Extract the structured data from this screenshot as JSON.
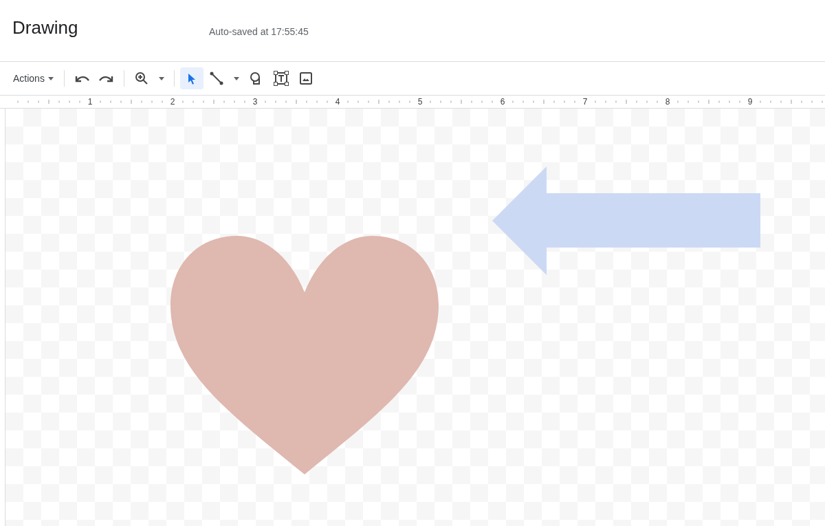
{
  "header": {
    "title": "Drawing",
    "save_status": "Auto-saved at 17:55:45"
  },
  "toolbar": {
    "menu": "Actions",
    "tools": [
      {
        "kind": "undo",
        "selected": false
      },
      {
        "kind": "redo",
        "selected": false
      },
      {
        "kind": "zoom",
        "selected": false
      },
      {
        "kind": "select",
        "selected": true
      },
      {
        "kind": "line",
        "selected": false
      },
      {
        "kind": "shape",
        "selected": false
      },
      {
        "kind": "textbox",
        "selected": false
      },
      {
        "kind": "image",
        "selected": false
      }
    ]
  },
  "ruler": {
    "labels": [
      "1",
      "2",
      "3",
      "4",
      "5",
      "6",
      "7",
      "8",
      "9"
    ]
  },
  "shapes": [
    {
      "kind": "heart",
      "color": "#dfb8b0"
    },
    {
      "kind": "arrow",
      "color": "#cbd9f4"
    }
  ]
}
